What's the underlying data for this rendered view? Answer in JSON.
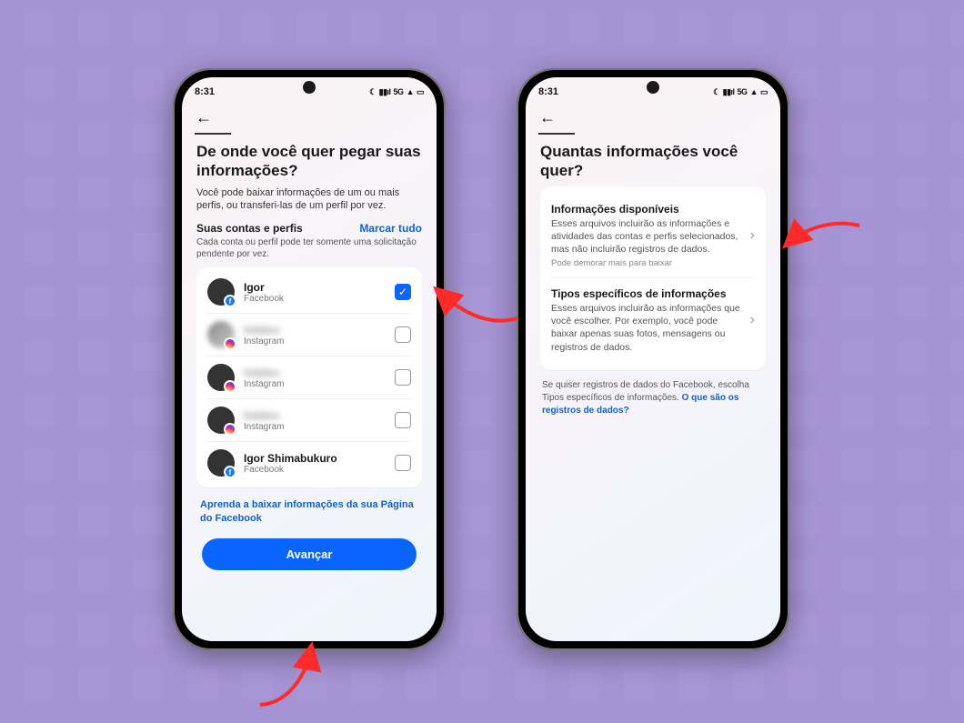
{
  "status": {
    "time": "8:31",
    "right": "5G"
  },
  "left": {
    "title": "De onde você quer pegar suas informações?",
    "subtitle": "Você pode baixar informações de um ou mais perfis, ou transferi-las de um perfil por vez.",
    "section_label": "Suas contas e perfis",
    "mark_all": "Marcar tudo",
    "note": "Cada conta ou perfil pode ter somente uma solicitação pendente por vez.",
    "accounts": [
      {
        "name": "Igor",
        "platform": "Facebook",
        "badge": "fb",
        "checked": true,
        "blur_name": false,
        "blur_av": false
      },
      {
        "name": "hidden",
        "platform": "Instagram",
        "badge": "ig",
        "checked": false,
        "blur_name": true,
        "blur_av": true
      },
      {
        "name": "hidden",
        "platform": "Instagram",
        "badge": "ig",
        "checked": false,
        "blur_name": true,
        "blur_av": false
      },
      {
        "name": "hidden",
        "platform": "Instagram",
        "badge": "ig",
        "checked": false,
        "blur_name": true,
        "blur_av": false
      },
      {
        "name": "Igor Shimabukuro",
        "platform": "Facebook",
        "badge": "fb",
        "checked": false,
        "blur_name": false,
        "blur_av": false
      }
    ],
    "learn_link": "Aprenda a baixar informações da sua Página do Facebook",
    "primary": "Avançar"
  },
  "right": {
    "title": "Quantas informações você quer?",
    "options": [
      {
        "title": "Informações disponíveis",
        "desc": "Esses arquivos incluirão as informações e atividades das contas e perfis selecionados, mas não incluirão registros de dados.",
        "hint": "Pode demorar mais para baixar"
      },
      {
        "title": "Tipos específicos de informações",
        "desc": "Esses arquivos incluirão as informações que você escolher. Por exemplo, você pode baixar apenas suas fotos, mensagens ou registros de dados.",
        "hint": ""
      }
    ],
    "footnote_a": "Se quiser registros de dados do Facebook, escolha Tipos específicos de informações. ",
    "footnote_link": "O que são os registros de dados?"
  }
}
